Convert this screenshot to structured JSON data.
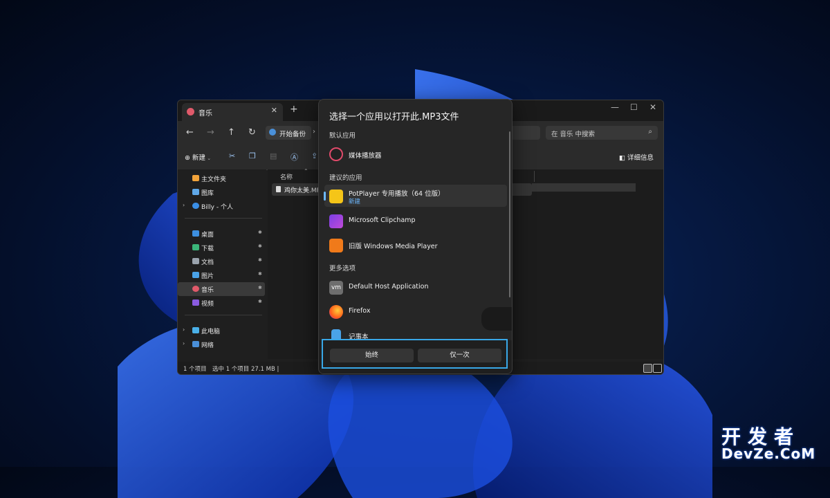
{
  "explorer": {
    "tab_title": "音乐",
    "tab_close": "✕",
    "new_tab": "+",
    "nav": {
      "back": "←",
      "forward": "→",
      "up": "↑",
      "refresh": "↻"
    },
    "breadcrumb": "开始备份",
    "breadcrumb_arrow": "›",
    "search_placeholder": "在 音乐 中搜索",
    "toolbar": {
      "new_label": "新建",
      "details_label": "详细信息"
    },
    "sidebar": {
      "home": "主文件夹",
      "gallery": "图库",
      "onedrive": "Billy - 个人",
      "desktop": "桌面",
      "downloads": "下载",
      "documents": "文档",
      "pictures": "图片",
      "music": "音乐",
      "videos": "视频",
      "this_pc": "此电脑",
      "network": "网络"
    },
    "column_name": "名称",
    "file_name": "鸡你太美.MP3",
    "status": {
      "count": "1 个项目",
      "selection": "选中 1 个项目  27.1 MB  |"
    }
  },
  "dialog": {
    "title": "选择一个应用以打开此.MP3文件",
    "default_section": "默认应用",
    "default_app": "媒体播放器",
    "suggested_section": "建议的应用",
    "suggested_apps": [
      {
        "name": "PotPlayer 专用播放（64 位版）",
        "badge": "新建"
      },
      {
        "name": "Microsoft Clipchamp"
      },
      {
        "name": "旧版 Windows Media Player"
      }
    ],
    "more_section": "更多选项",
    "more_apps": [
      {
        "name": "Default Host Application"
      },
      {
        "name": "Firefox"
      },
      {
        "name": "记事本"
      }
    ],
    "always_button": "始终",
    "once_button": "仅一次"
  },
  "watermark": {
    "line1": "开发者",
    "line2": "DevZe.CoM"
  },
  "colors": {
    "accent": "#39a8e8",
    "link": "#6cb8ff",
    "dialog_bg": "#262626"
  }
}
